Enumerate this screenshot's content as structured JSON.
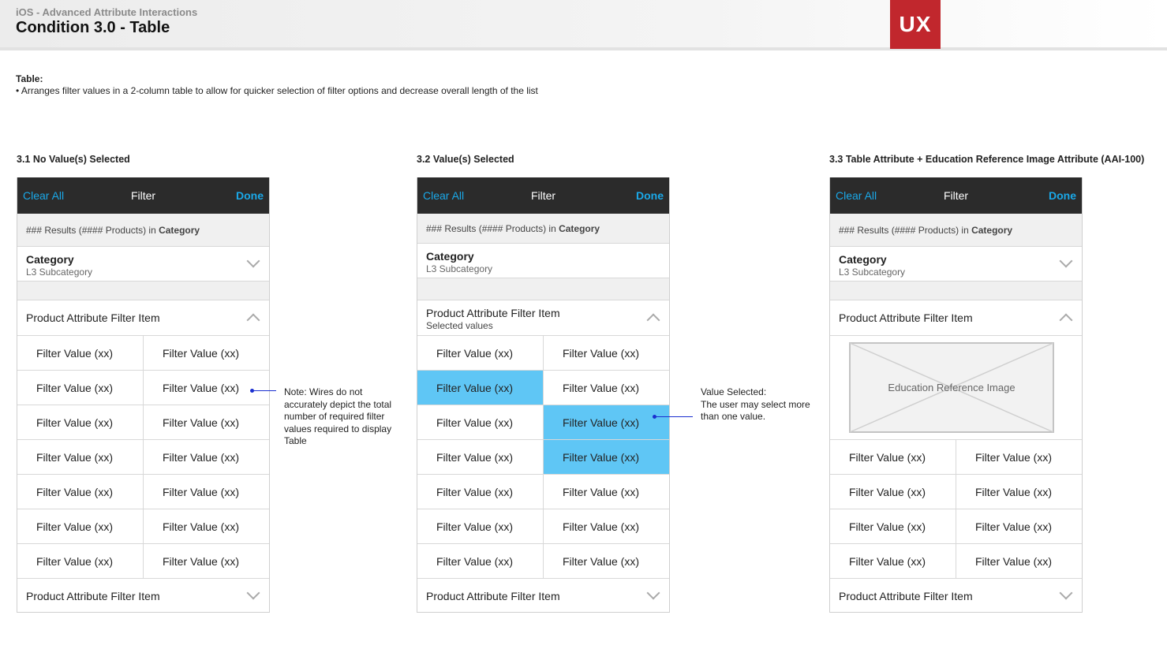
{
  "header": {
    "subtitle": "iOS - Advanced Attribute Interactions",
    "title": "Condition 3.0 - Table",
    "logo": "UX"
  },
  "intro": {
    "label": "Table:",
    "bullet": "• Arranges filter values in a 2-column table to allow for quicker selection of filter options and decrease overall length of the list"
  },
  "sections": [
    {
      "title": "3.1 No Value(s) Selected"
    },
    {
      "title": "3.2 Value(s) Selected"
    },
    {
      "title": "3.3 Table Attribute + Education Reference Image Attribute (AAI-100)"
    }
  ],
  "navbar": {
    "clear": "Clear All",
    "title": "Filter",
    "done": "Done"
  },
  "results": {
    "prefix": "### Results (#### Products) in ",
    "category": "Category"
  },
  "category": {
    "name": "Category",
    "sub": "L3 Subcategory"
  },
  "attribute": {
    "name": "Product Attribute Filter Item",
    "selected_sub": "Selected values"
  },
  "filter_value": "Filter Value (xx)",
  "education": {
    "label": "Education Reference Image"
  },
  "notes": {
    "wires": "Note: Wires do not accurately depict the total number of required filter values required to display Table",
    "selected_title": "Value Selected:",
    "selected_body": "The user may select more than one value."
  },
  "colors": {
    "accent": "#1aa8e8",
    "selected": "#5fc6f5",
    "brand": "#c1272d",
    "navbar": "#2b2b2b"
  }
}
